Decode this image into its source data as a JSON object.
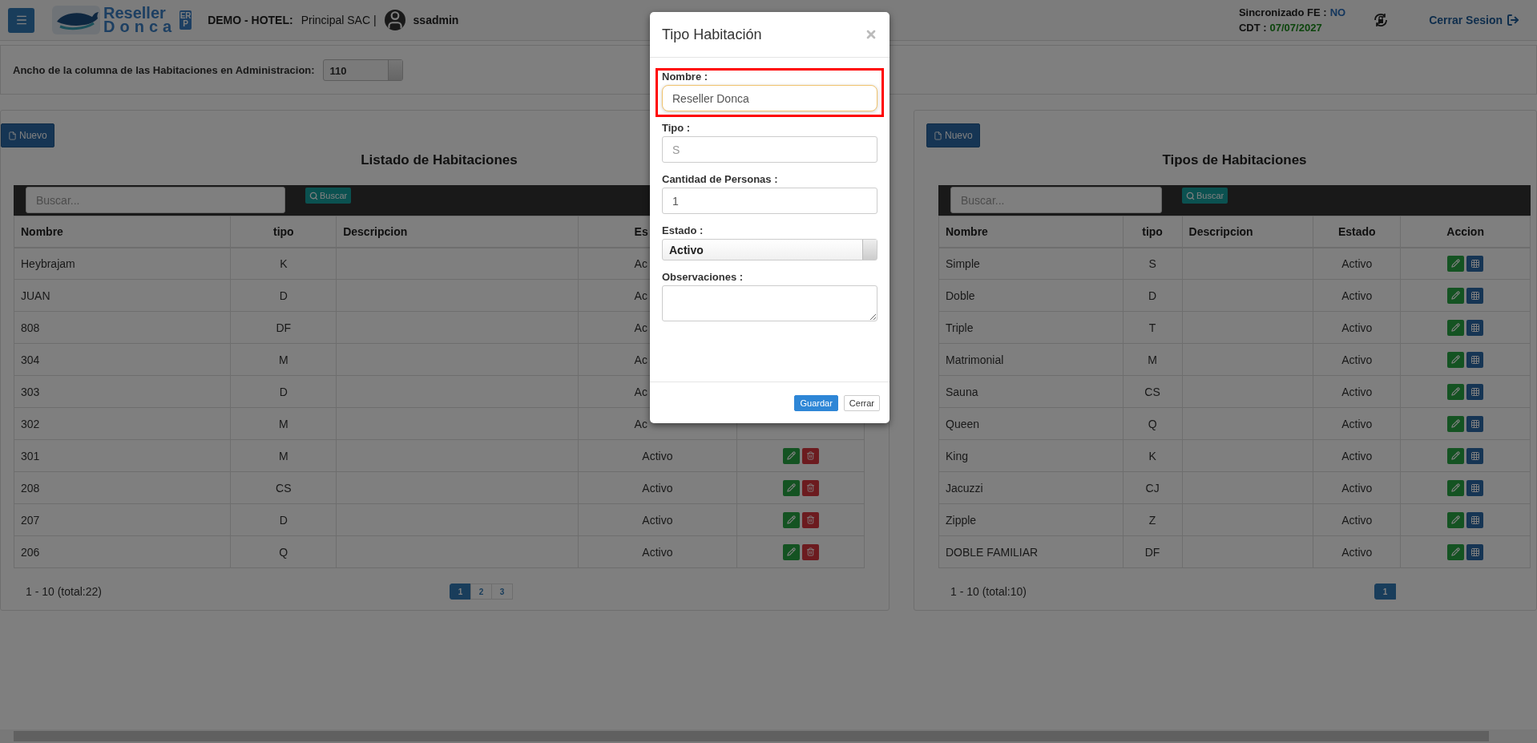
{
  "header": {
    "logo": {
      "line1": "Reseller",
      "line2": "Donca",
      "badge": "ERP"
    },
    "company_label": "DEMO - HOTEL:",
    "company": "Principal SAC |",
    "user": "ssadmin",
    "sync_label": "Sincronizado FE :",
    "sync_value": "NO",
    "cdt_label": "CDT :",
    "cdt_value": "07/07/2027",
    "logout": "Cerrar Sesion"
  },
  "settings": {
    "label": "Ancho de la columna de las Habitaciones en Administracion:",
    "value": "110"
  },
  "rooms_panel": {
    "new_button": "Nuevo",
    "title": "Listado de Habitaciones",
    "search": {
      "placeholder": "Buscar...",
      "button": "Buscar"
    },
    "columns": [
      "Nombre",
      "tipo",
      "Descripcion",
      "Es"
    ],
    "rows": [
      {
        "name": "Heybrajam",
        "tipo": "K",
        "estado": "Ac"
      },
      {
        "name": "JUAN",
        "tipo": "D",
        "estado": "Ac"
      },
      {
        "name": "808",
        "tipo": "DF",
        "estado": "Ac"
      },
      {
        "name": "304",
        "tipo": "M",
        "estado": "Ac"
      },
      {
        "name": "303",
        "tipo": "D",
        "estado": "Ac"
      },
      {
        "name": "302",
        "tipo": "M",
        "estado": "Ac"
      },
      {
        "name": "301",
        "tipo": "M",
        "estado": "Activo"
      },
      {
        "name": "208",
        "tipo": "CS",
        "estado": "Activo"
      },
      {
        "name": "207",
        "tipo": "D",
        "estado": "Activo"
      },
      {
        "name": "206",
        "tipo": "Q",
        "estado": "Activo"
      }
    ],
    "summary": "1 - 10 (total:22)",
    "pages": [
      {
        "label": "1",
        "selected": true
      },
      {
        "label": "2",
        "selected": false
      },
      {
        "label": "3",
        "selected": false
      }
    ]
  },
  "types_panel": {
    "new_button": "Nuevo",
    "title": "Tipos de Habitaciones",
    "search": {
      "placeholder": "Buscar...",
      "button": "Buscar"
    },
    "columns": [
      "Nombre",
      "tipo",
      "Descripcion",
      "Estado",
      "Accion"
    ],
    "rows": [
      {
        "name": "Simple",
        "tipo": "S",
        "estado": "Activo"
      },
      {
        "name": "Doble",
        "tipo": "D",
        "estado": "Activo"
      },
      {
        "name": "Triple",
        "tipo": "T",
        "estado": "Activo"
      },
      {
        "name": "Matrimonial",
        "tipo": "M",
        "estado": "Activo"
      },
      {
        "name": "Sauna",
        "tipo": "CS",
        "estado": "Activo"
      },
      {
        "name": "Queen",
        "tipo": "Q",
        "estado": "Activo"
      },
      {
        "name": "King",
        "tipo": "K",
        "estado": "Activo"
      },
      {
        "name": "Jacuzzi",
        "tipo": "CJ",
        "estado": "Activo"
      },
      {
        "name": "Zipple",
        "tipo": "Z",
        "estado": "Activo"
      },
      {
        "name": "DOBLE FAMILIAR",
        "tipo": "DF",
        "estado": "Activo"
      }
    ],
    "summary": "1 - 10 (total:10)",
    "pages": [
      {
        "label": "1",
        "selected": true
      }
    ]
  },
  "modal": {
    "title": "Tipo Habitación",
    "fields": [
      {
        "kind": "text",
        "label": "Nombre :",
        "value": "Reseller Donca",
        "highlighted": true
      },
      {
        "kind": "text",
        "label": "Tipo :",
        "placeholder": "S",
        "highlighted": false
      },
      {
        "kind": "text",
        "label": "Cantidad de Personas :",
        "value": "1",
        "highlighted": false
      },
      {
        "kind": "select",
        "label": "Estado :",
        "value": "Activo",
        "highlighted": false
      },
      {
        "kind": "textarea",
        "label": "Observaciones :",
        "highlighted": false
      }
    ],
    "buttons": [
      {
        "label": "Guardar",
        "kind": "primary"
      },
      {
        "label": "Cerrar",
        "kind": "default"
      }
    ]
  }
}
